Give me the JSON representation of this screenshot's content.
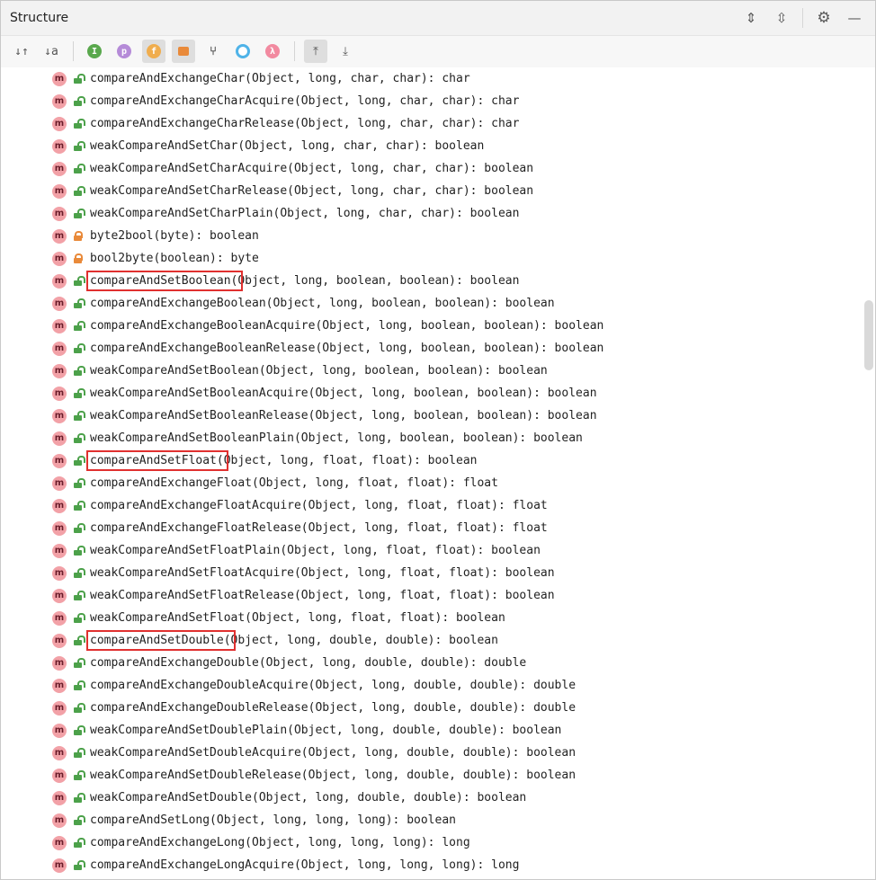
{
  "panel": {
    "title": "Structure",
    "title_actions": [
      {
        "name": "expand-all-icon",
        "glyph": "⇕"
      },
      {
        "name": "collapse-all-icon",
        "glyph": "⇳"
      },
      {
        "name": "gear-icon",
        "glyph": "⚙"
      },
      {
        "name": "minimize-icon",
        "glyph": "—"
      }
    ]
  },
  "toolbar": {
    "tools": [
      {
        "name": "sort-by-visibility-icon",
        "glyph": "↓↑",
        "active": false
      },
      {
        "name": "sort-alphabetically-icon",
        "glyph": "↓a",
        "active": false
      },
      {
        "name": "show-inherited-icon",
        "glyph": "I",
        "color": "#59a84d",
        "active": false
      },
      {
        "name": "show-properties-icon",
        "glyph": "p",
        "color": "#b58bd8",
        "active": false
      },
      {
        "name": "show-fields-icon",
        "glyph": "f",
        "color": "#f0ad4e",
        "active": true
      },
      {
        "name": "show-non-public-icon",
        "glyph": "",
        "color": "#e98a3a",
        "active": true
      },
      {
        "name": "show-anonymous-icon",
        "glyph": "",
        "color": "#555555",
        "active": false
      },
      {
        "name": "show-lambdas-icon",
        "glyph": "",
        "color": "#4fb3e8",
        "active": false
      },
      {
        "name": "show-lambda-icon",
        "glyph": "λ",
        "color": "#f28aa0",
        "active": false
      },
      {
        "name": "autoscroll-to-source-icon",
        "glyph": "⤒",
        "active": true
      },
      {
        "name": "autoscroll-from-source-icon",
        "glyph": "⤓",
        "active": false
      }
    ]
  },
  "colors": {
    "highlight": "#e0302f",
    "method_icon": "#f2a1a7",
    "public_lock": "#4ca14a",
    "private_lock": "#e98a3a"
  },
  "methods": [
    {
      "sig": "compareAndExchangeChar(Object, long, char, char): char",
      "vis": "public"
    },
    {
      "sig": "compareAndExchangeCharAcquire(Object, long, char, char): char",
      "vis": "public"
    },
    {
      "sig": "compareAndExchangeCharRelease(Object, long, char, char): char",
      "vis": "public"
    },
    {
      "sig": "weakCompareAndSetChar(Object, long, char, char): boolean",
      "vis": "public"
    },
    {
      "sig": "weakCompareAndSetCharAcquire(Object, long, char, char): boolean",
      "vis": "public"
    },
    {
      "sig": "weakCompareAndSetCharRelease(Object, long, char, char): boolean",
      "vis": "public"
    },
    {
      "sig": "weakCompareAndSetCharPlain(Object, long, char, char): boolean",
      "vis": "public"
    },
    {
      "sig": "byte2bool(byte): boolean",
      "vis": "private"
    },
    {
      "sig": "bool2byte(boolean): byte",
      "vis": "private"
    },
    {
      "sig": "compareAndSetBoolean(Object, long, boolean, boolean): boolean",
      "vis": "public",
      "highlight_chars": 21
    },
    {
      "sig": "compareAndExchangeBoolean(Object, long, boolean, boolean): boolean",
      "vis": "public"
    },
    {
      "sig": "compareAndExchangeBooleanAcquire(Object, long, boolean, boolean): boolean",
      "vis": "public"
    },
    {
      "sig": "compareAndExchangeBooleanRelease(Object, long, boolean, boolean): boolean",
      "vis": "public"
    },
    {
      "sig": "weakCompareAndSetBoolean(Object, long, boolean, boolean): boolean",
      "vis": "public"
    },
    {
      "sig": "weakCompareAndSetBooleanAcquire(Object, long, boolean, boolean): boolean",
      "vis": "public"
    },
    {
      "sig": "weakCompareAndSetBooleanRelease(Object, long, boolean, boolean): boolean",
      "vis": "public"
    },
    {
      "sig": "weakCompareAndSetBooleanPlain(Object, long, boolean, boolean): boolean",
      "vis": "public"
    },
    {
      "sig": "compareAndSetFloat(Object, long, float, float): boolean",
      "vis": "public",
      "highlight_chars": 19
    },
    {
      "sig": "compareAndExchangeFloat(Object, long, float, float): float",
      "vis": "public"
    },
    {
      "sig": "compareAndExchangeFloatAcquire(Object, long, float, float): float",
      "vis": "public"
    },
    {
      "sig": "compareAndExchangeFloatRelease(Object, long, float, float): float",
      "vis": "public"
    },
    {
      "sig": "weakCompareAndSetFloatPlain(Object, long, float, float): boolean",
      "vis": "public"
    },
    {
      "sig": "weakCompareAndSetFloatAcquire(Object, long, float, float): boolean",
      "vis": "public"
    },
    {
      "sig": "weakCompareAndSetFloatRelease(Object, long, float, float): boolean",
      "vis": "public"
    },
    {
      "sig": "weakCompareAndSetFloat(Object, long, float, float): boolean",
      "vis": "public"
    },
    {
      "sig": "compareAndSetDouble(Object, long, double, double): boolean",
      "vis": "public",
      "highlight_chars": 20
    },
    {
      "sig": "compareAndExchangeDouble(Object, long, double, double): double",
      "vis": "public"
    },
    {
      "sig": "compareAndExchangeDoubleAcquire(Object, long, double, double): double",
      "vis": "public"
    },
    {
      "sig": "compareAndExchangeDoubleRelease(Object, long, double, double): double",
      "vis": "public"
    },
    {
      "sig": "weakCompareAndSetDoublePlain(Object, long, double, double): boolean",
      "vis": "public"
    },
    {
      "sig": "weakCompareAndSetDoubleAcquire(Object, long, double, double): boolean",
      "vis": "public"
    },
    {
      "sig": "weakCompareAndSetDoubleRelease(Object, long, double, double): boolean",
      "vis": "public"
    },
    {
      "sig": "weakCompareAndSetDouble(Object, long, double, double): boolean",
      "vis": "public"
    },
    {
      "sig": "compareAndSetLong(Object, long, long, long): boolean",
      "vis": "public"
    },
    {
      "sig": "compareAndExchangeLong(Object, long, long, long): long",
      "vis": "public"
    },
    {
      "sig": "compareAndExchangeLongAcquire(Object, long, long, long): long",
      "vis": "public"
    }
  ]
}
